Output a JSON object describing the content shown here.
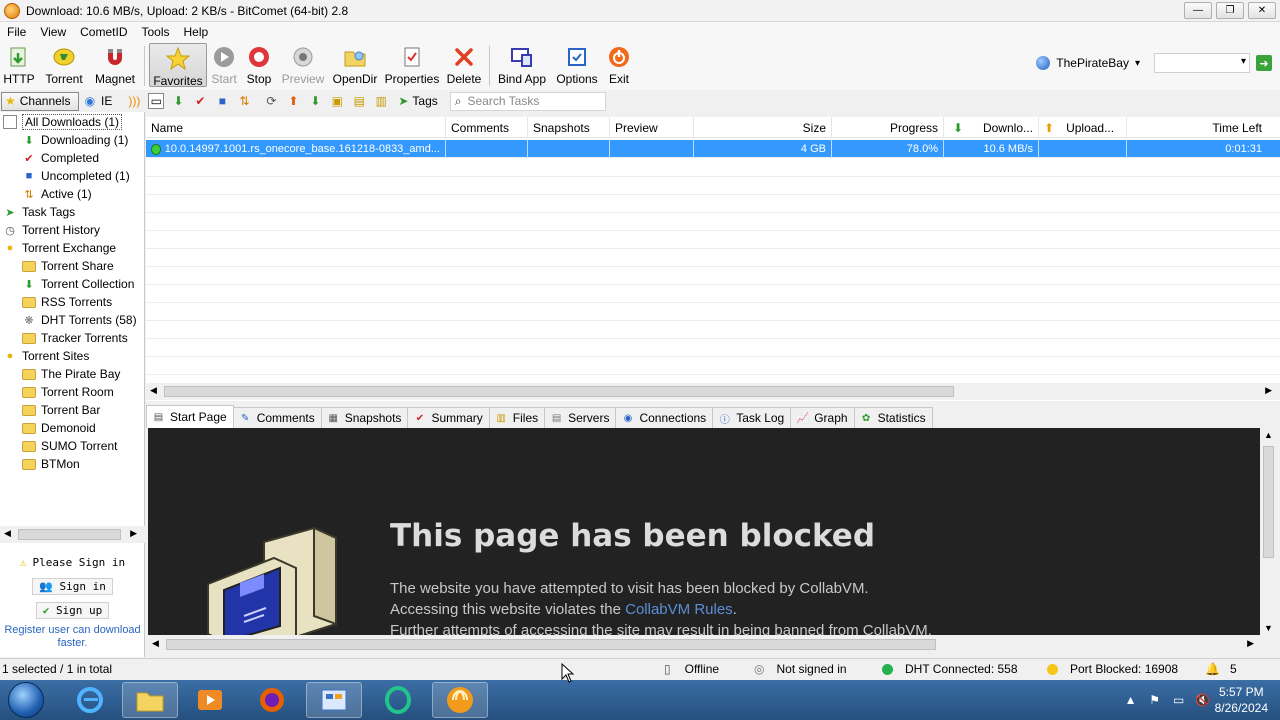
{
  "window": {
    "title": "Download: 10.6 MB/s, Upload: 2 KB/s - BitComet (64-bit) 2.8",
    "controls": [
      "—",
      "❐",
      "✕"
    ]
  },
  "menu": [
    "File",
    "View",
    "CometID",
    "Tools",
    "Help"
  ],
  "toolbar": {
    "http": "HTTP",
    "torrent": "Torrent",
    "magnet": "Magnet",
    "favorites": "Favorites",
    "start": "Start",
    "stop": "Stop",
    "preview": "Preview",
    "opendir": "OpenDir",
    "properties": "Properties",
    "delete": "Delete",
    "bindapp": "Bind App",
    "options": "Options",
    "exit": "Exit",
    "site_name": "ThePirateBay"
  },
  "subbar": {
    "channels": "Channels",
    "ie": "IE",
    "tags": "Tags",
    "search_placeholder": "Search Tasks"
  },
  "tree": {
    "all_downloads": "All Downloads (1)",
    "downloading": "Downloading (1)",
    "completed": "Completed",
    "uncompleted": "Uncompleted (1)",
    "active": "Active (1)",
    "task_tags": "Task Tags",
    "torrent_history": "Torrent History",
    "torrent_exchange": "Torrent Exchange",
    "torrent_share": "Torrent Share",
    "torrent_collection": "Torrent Collection",
    "rss_torrents": "RSS Torrents",
    "dht_torrents": "DHT Torrents (58)",
    "tracker_torrents": "Tracker Torrents",
    "torrent_sites": "Torrent Sites",
    "the_pirate_bay": "The Pirate Bay",
    "torrent_room": "Torrent Room",
    "torrent_bar": "Torrent Bar",
    "demonoid": "Demonoid",
    "sumo_torrent": "SUMO Torrent",
    "btmon": "BTMon"
  },
  "sign": {
    "please": "Please Sign in",
    "signin": "Sign in",
    "signup": "Sign up",
    "register": "Register user can download faster."
  },
  "columns": {
    "name": "Name",
    "comments": "Comments",
    "snapshots": "Snapshots",
    "preview": "Preview",
    "size": "Size",
    "progress": "Progress",
    "download": "Downlo...",
    "upload": "Upload...",
    "time_left": "Time Left"
  },
  "task": {
    "name": "10.0.14997.1001.rs_onecore_base.161218-0833_amd...",
    "size": "4 GB",
    "progress": "78.0%",
    "progress_value": 78.0,
    "download": "10.6 MB/s",
    "upload": "",
    "time_left": "0:01:31"
  },
  "tabs": [
    "Start Page",
    "Comments",
    "Snapshots",
    "Summary",
    "Files",
    "Servers",
    "Connections",
    "Task Log",
    "Graph",
    "Statistics"
  ],
  "blocked": {
    "title": "This page has been blocked",
    "line1": "The website you have attempted to visit has been blocked by CollabVM.",
    "line2_prefix": "Accessing this website violates the ",
    "line2_link": "CollabVM Rules",
    "line2_suffix": ".",
    "line3": "Further attempts of accessing the site may result in being banned from CollabVM."
  },
  "status": {
    "selection": "1 selected / 1 in total",
    "offline": "Offline",
    "not_signed": "Not signed in",
    "dht": "DHT Connected: 558",
    "port": "Port Blocked: 16908",
    "count": "5"
  },
  "taskbar": {
    "time": "5:57 PM",
    "date": "8/26/2024"
  },
  "colors": {
    "selection": "#3399ff",
    "dht_dot": "#22b14c",
    "port_dot": "#f5c518",
    "browser_bg": "#222222"
  }
}
